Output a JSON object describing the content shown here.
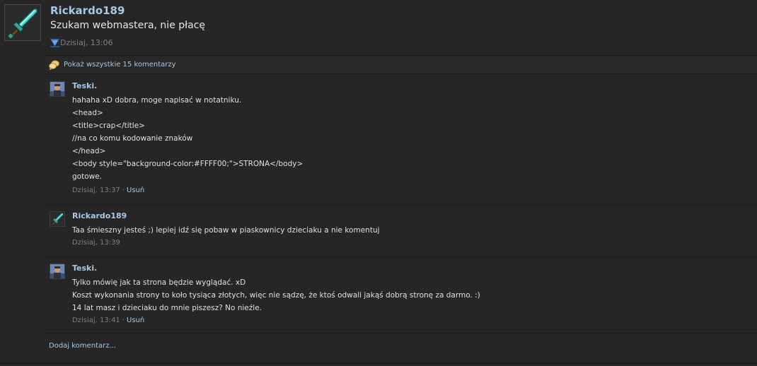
{
  "post": {
    "author": "Rickardo189",
    "text": "Szukam webmastera, nie płacę",
    "time": "Dzisiaj, 13:06",
    "avatar_icon": "diamond-sword-icon",
    "source_icon": "status-source-icon"
  },
  "show_all": {
    "label": "Pokaż wszystkie 15 komentarzy",
    "icon": "comments-icon"
  },
  "comments": [
    {
      "author": "Teski.",
      "lines": [
        "hahaha xD dobra, moge napisać w notatniku.",
        "<head>",
        "<title>crap</title>",
        "//na co komu kodowanie znaków",
        "</head>",
        "<body style=\"background-color:#FFFF00;\">STRONA</body>",
        "gotowe."
      ],
      "time": "Dzisiaj, 13:37",
      "separator": "·",
      "delete_label": "Usuń"
    },
    {
      "author": "Rickardo189",
      "lines": [
        "Taa śmieszny jesteś ;) lepiej idź się pobaw w piaskownicy dzieciaku a nie komentuj"
      ],
      "time": "Dzisiaj, 13:39"
    },
    {
      "author": "Teski.",
      "lines": [
        "Tylko mówię jak ta strona będzie wyglądać. xD",
        "Koszt wykonania strony to koło tysiąca złotych, więc nie sądzę, że ktoś odwali jakąś dobrą stronę za darmo. :)",
        "14 lat masz i dzieciaku do mnie piszesz? No nieźle."
      ],
      "time": "Dzisiaj, 13:41",
      "separator": "·",
      "delete_label": "Usuń"
    }
  ],
  "add_comment": {
    "label": "Dodaj komentarz..."
  },
  "colors": {
    "background": "#262626",
    "link": "#a9c8e4",
    "text": "#e0e0e0",
    "muted": "#7f7f7f"
  }
}
